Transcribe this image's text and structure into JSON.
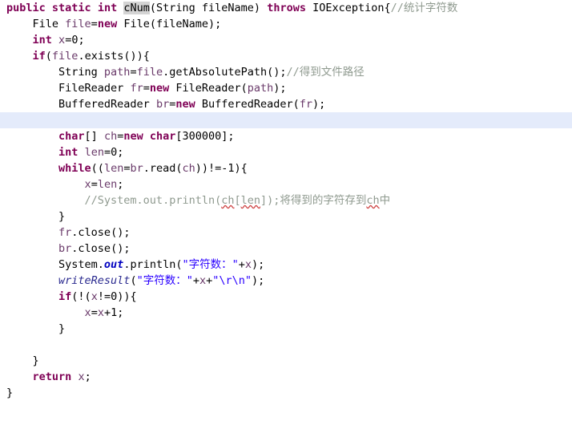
{
  "editor": {
    "language": "java",
    "colors": {
      "background": "#ffffff",
      "foreground": "#000000",
      "keyword": "#7f0055",
      "string": "#2a00ff",
      "comment": "#8f9a8f",
      "local_variable": "#6a3a6a",
      "static_field": "#0000c0",
      "static_method": "#2a2a8f",
      "occurrence_highlight": "#d4d4d4",
      "current_line_highlight": "#e4ebfb",
      "spelling_error_underline": "#d04a4a"
    },
    "highlighted_line_index": 7,
    "occurrence_token": "cNum",
    "lines": [
      {
        "index": 0,
        "text": "public static int cNum(String fileName) throws IOException{//统计字符数",
        "tokens": [
          {
            "t": "public",
            "c": "kw"
          },
          {
            "t": " ",
            "c": "plain"
          },
          {
            "t": "static",
            "c": "kw"
          },
          {
            "t": " ",
            "c": "plain"
          },
          {
            "t": "int",
            "c": "kw"
          },
          {
            "t": " ",
            "c": "plain"
          },
          {
            "t": "cNum",
            "c": "occ"
          },
          {
            "t": "(String fileName) ",
            "c": "plain"
          },
          {
            "t": "throws",
            "c": "kw"
          },
          {
            "t": " IOException{",
            "c": "plain"
          },
          {
            "t": "//统计字符数",
            "c": "cmt"
          }
        ]
      },
      {
        "index": 1,
        "text": "    File file=new File(fileName);",
        "tokens": [
          {
            "t": "    File ",
            "c": "plain"
          },
          {
            "t": "file",
            "c": "var"
          },
          {
            "t": "=",
            "c": "plain"
          },
          {
            "t": "new",
            "c": "kw"
          },
          {
            "t": " File(fileName);",
            "c": "plain"
          }
        ]
      },
      {
        "index": 2,
        "text": "    int x=0;",
        "tokens": [
          {
            "t": "    ",
            "c": "plain"
          },
          {
            "t": "int",
            "c": "kw"
          },
          {
            "t": " ",
            "c": "plain"
          },
          {
            "t": "x",
            "c": "var"
          },
          {
            "t": "=0;",
            "c": "plain"
          }
        ]
      },
      {
        "index": 3,
        "text": "    if(file.exists()){",
        "tokens": [
          {
            "t": "    ",
            "c": "plain"
          },
          {
            "t": "if",
            "c": "kw"
          },
          {
            "t": "(",
            "c": "plain"
          },
          {
            "t": "file",
            "c": "var"
          },
          {
            "t": ".exists()){",
            "c": "plain"
          }
        ]
      },
      {
        "index": 4,
        "text": "        String path=file.getAbsolutePath();//得到文件路径",
        "tokens": [
          {
            "t": "        String ",
            "c": "plain"
          },
          {
            "t": "path",
            "c": "var"
          },
          {
            "t": "=",
            "c": "plain"
          },
          {
            "t": "file",
            "c": "var"
          },
          {
            "t": ".getAbsolutePath();",
            "c": "plain"
          },
          {
            "t": "//得到文件路径",
            "c": "cmt"
          }
        ]
      },
      {
        "index": 5,
        "text": "        FileReader fr=new FileReader(path);",
        "tokens": [
          {
            "t": "        FileReader ",
            "c": "plain"
          },
          {
            "t": "fr",
            "c": "var"
          },
          {
            "t": "=",
            "c": "plain"
          },
          {
            "t": "new",
            "c": "kw"
          },
          {
            "t": " FileReader(",
            "c": "plain"
          },
          {
            "t": "path",
            "c": "var"
          },
          {
            "t": ");",
            "c": "plain"
          }
        ]
      },
      {
        "index": 6,
        "text": "        BufferedReader br=new BufferedReader(fr);",
        "tokens": [
          {
            "t": "        BufferedReader ",
            "c": "plain"
          },
          {
            "t": "br",
            "c": "var"
          },
          {
            "t": "=",
            "c": "plain"
          },
          {
            "t": "new",
            "c": "kw"
          },
          {
            "t": " BufferedReader(",
            "c": "plain"
          },
          {
            "t": "fr",
            "c": "var"
          },
          {
            "t": ");",
            "c": "plain"
          }
        ]
      },
      {
        "index": 7,
        "text": "",
        "tokens": []
      },
      {
        "index": 8,
        "text": "        char[] ch=new char[300000];",
        "tokens": [
          {
            "t": "        ",
            "c": "plain"
          },
          {
            "t": "char",
            "c": "kw"
          },
          {
            "t": "[] ",
            "c": "plain"
          },
          {
            "t": "ch",
            "c": "var"
          },
          {
            "t": "=",
            "c": "plain"
          },
          {
            "t": "new",
            "c": "kw"
          },
          {
            "t": " ",
            "c": "plain"
          },
          {
            "t": "char",
            "c": "kw"
          },
          {
            "t": "[300000];",
            "c": "plain"
          }
        ]
      },
      {
        "index": 9,
        "text": "        int len=0;",
        "tokens": [
          {
            "t": "        ",
            "c": "plain"
          },
          {
            "t": "int",
            "c": "kw"
          },
          {
            "t": " ",
            "c": "plain"
          },
          {
            "t": "len",
            "c": "var"
          },
          {
            "t": "=0;",
            "c": "plain"
          }
        ]
      },
      {
        "index": 10,
        "text": "        while((len=br.read(ch))!=-1){",
        "tokens": [
          {
            "t": "        ",
            "c": "plain"
          },
          {
            "t": "while",
            "c": "kw"
          },
          {
            "t": "((",
            "c": "plain"
          },
          {
            "t": "len",
            "c": "var"
          },
          {
            "t": "=",
            "c": "plain"
          },
          {
            "t": "br",
            "c": "var"
          },
          {
            "t": ".read(",
            "c": "plain"
          },
          {
            "t": "ch",
            "c": "var"
          },
          {
            "t": "))!=-1){",
            "c": "plain"
          }
        ]
      },
      {
        "index": 11,
        "text": "            x=len;",
        "tokens": [
          {
            "t": "            ",
            "c": "plain"
          },
          {
            "t": "x",
            "c": "var"
          },
          {
            "t": "=",
            "c": "plain"
          },
          {
            "t": "len",
            "c": "var"
          },
          {
            "t": ";",
            "c": "plain"
          }
        ]
      },
      {
        "index": 12,
        "text": "            //System.out.println(ch[len]);将得到的字符存到ch中",
        "tokens": [
          {
            "t": "            //System.out.println(",
            "c": "cmt"
          },
          {
            "t": "ch",
            "c": "cmt sq"
          },
          {
            "t": "[",
            "c": "cmt"
          },
          {
            "t": "len",
            "c": "cmt sq"
          },
          {
            "t": "]);",
            "c": "cmt"
          },
          {
            "t": "将得到的字符存到",
            "c": "cmt"
          },
          {
            "t": "ch",
            "c": "cmt sq"
          },
          {
            "t": "中",
            "c": "cmt"
          }
        ]
      },
      {
        "index": 13,
        "text": "        }",
        "tokens": [
          {
            "t": "        }",
            "c": "plain"
          }
        ]
      },
      {
        "index": 14,
        "text": "        fr.close();",
        "tokens": [
          {
            "t": "        ",
            "c": "plain"
          },
          {
            "t": "fr",
            "c": "var"
          },
          {
            "t": ".close();",
            "c": "plain"
          }
        ]
      },
      {
        "index": 15,
        "text": "        br.close();",
        "tokens": [
          {
            "t": "        ",
            "c": "plain"
          },
          {
            "t": "br",
            "c": "var"
          },
          {
            "t": ".close();",
            "c": "plain"
          }
        ]
      },
      {
        "index": 16,
        "text": "        System.out.println(\"字符数：\"+x);",
        "tokens": [
          {
            "t": "        System.",
            "c": "plain"
          },
          {
            "t": "out",
            "c": "fld"
          },
          {
            "t": ".println(",
            "c": "plain"
          },
          {
            "t": "\"字符数：\"",
            "c": "str"
          },
          {
            "t": "+",
            "c": "plain"
          },
          {
            "t": "x",
            "c": "var"
          },
          {
            "t": ");",
            "c": "plain"
          }
        ]
      },
      {
        "index": 17,
        "text": "        writeResult(\"字符数：\"+x+\"\\r\\n\");",
        "tokens": [
          {
            "t": "        ",
            "c": "plain"
          },
          {
            "t": "writeResult",
            "c": "mth"
          },
          {
            "t": "(",
            "c": "plain"
          },
          {
            "t": "\"字符数：\"",
            "c": "str"
          },
          {
            "t": "+",
            "c": "plain"
          },
          {
            "t": "x",
            "c": "var"
          },
          {
            "t": "+",
            "c": "plain"
          },
          {
            "t": "\"\\r\\n\"",
            "c": "str"
          },
          {
            "t": ");",
            "c": "plain"
          }
        ]
      },
      {
        "index": 18,
        "text": "        if(!(x!=0)){",
        "tokens": [
          {
            "t": "        ",
            "c": "plain"
          },
          {
            "t": "if",
            "c": "kw"
          },
          {
            "t": "(!(",
            "c": "plain"
          },
          {
            "t": "x",
            "c": "var"
          },
          {
            "t": "!=0)){",
            "c": "plain"
          }
        ]
      },
      {
        "index": 19,
        "text": "            x=x+1;",
        "tokens": [
          {
            "t": "            ",
            "c": "plain"
          },
          {
            "t": "x",
            "c": "var"
          },
          {
            "t": "=",
            "c": "plain"
          },
          {
            "t": "x",
            "c": "var"
          },
          {
            "t": "+1;",
            "c": "plain"
          }
        ]
      },
      {
        "index": 20,
        "text": "        }",
        "tokens": [
          {
            "t": "        }",
            "c": "plain"
          }
        ]
      },
      {
        "index": 21,
        "text": "",
        "tokens": []
      },
      {
        "index": 22,
        "text": "    }",
        "tokens": [
          {
            "t": "    }",
            "c": "plain"
          }
        ]
      },
      {
        "index": 23,
        "text": "    return x;",
        "tokens": [
          {
            "t": "    ",
            "c": "plain"
          },
          {
            "t": "return",
            "c": "kw"
          },
          {
            "t": " ",
            "c": "plain"
          },
          {
            "t": "x",
            "c": "var"
          },
          {
            "t": ";",
            "c": "plain"
          }
        ]
      },
      {
        "index": 24,
        "text": "}",
        "tokens": [
          {
            "t": "}",
            "c": "plain"
          }
        ]
      }
    ]
  }
}
